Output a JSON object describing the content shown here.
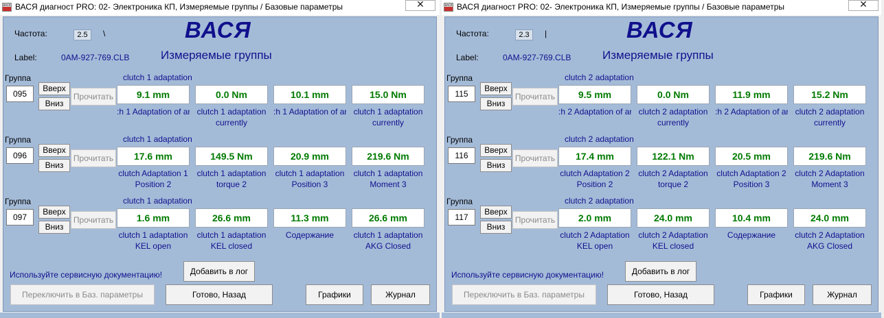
{
  "windows": [
    {
      "title": "ВАСЯ диагност PRO: 02- Электроника КП,  Измеряемые группы / Базовые параметры",
      "icon_text": "ВАСЯ",
      "close": "✕",
      "freq_label": "Частота:",
      "freq_value": "2.5",
      "spinner": "\\",
      "logo": "ВАСЯ",
      "label_label": "Label:",
      "label_value": "0AM-927-769.CLB",
      "heading": "Измеряемые группы",
      "groups": [
        {
          "label": "Группа",
          "number": "095",
          "up": "Вверх",
          "down": "Вниз",
          "read": "Прочитать",
          "title": "clutch 1 adaptation",
          "cells": [
            {
              "value": "9.1 mm",
              "desc1": ":h 1 Adaptation of ar",
              "desc2": ""
            },
            {
              "value": "0.0 Nm",
              "desc1": "clutch 1 adaptation",
              "desc2": "currently"
            },
            {
              "value": "10.1 mm",
              "desc1": ":h 1 Adaptation of ar",
              "desc2": ""
            },
            {
              "value": "15.0 Nm",
              "desc1": "clutch 1 adaptation",
              "desc2": "currently"
            }
          ]
        },
        {
          "label": "Группа",
          "number": "096",
          "up": "Вверх",
          "down": "Вниз",
          "read": "Прочитать",
          "title": "clutch 1 adaptation",
          "cells": [
            {
              "value": "17.6 mm",
              "desc1": "clutch Adaptation 1",
              "desc2": "Position 2"
            },
            {
              "value": "149.5 Nm",
              "desc1": "clutch 1 adaptation",
              "desc2": "torque 2"
            },
            {
              "value": "20.9 mm",
              "desc1": "clutch 1 adaptation",
              "desc2": "Position 3"
            },
            {
              "value": "219.6 Nm",
              "desc1": "clutch 1 adaptation",
              "desc2": "Moment 3"
            }
          ]
        },
        {
          "label": "Группа",
          "number": "097",
          "up": "Вверх",
          "down": "Вниз",
          "read": "Прочитать",
          "title": "clutch 1 adaptation",
          "cells": [
            {
              "value": "1.6 mm",
              "desc1": "clutch 1 adaptation",
              "desc2": "KEL open"
            },
            {
              "value": "26.6 mm",
              "desc1": "clutch 1 adaptation",
              "desc2": "KEL closed"
            },
            {
              "value": "11.3 mm",
              "desc1": "Содержание",
              "desc2": ""
            },
            {
              "value": "26.6 mm",
              "desc1": "clutch 1 adaptation",
              "desc2": "AKG Closed"
            }
          ]
        }
      ],
      "hint": "Используйте сервисную документацию!",
      "add_log": "Добавить в лог",
      "switch_basic": "Переключить в Баз. параметры",
      "done_back": "Готово, Назад",
      "graphs": "Графики",
      "journal": "Журнал"
    },
    {
      "title": "ВАСЯ диагност PRO: 02- Электроника КП,  Измеряемые группы / Базовые параметры",
      "icon_text": "ВАСЯ",
      "close": "✕",
      "freq_label": "Частота:",
      "freq_value": "2.3",
      "spinner": "|",
      "logo": "ВАСЯ",
      "label_label": "Label:",
      "label_value": "0AM-927-769.CLB",
      "heading": "Измеряемые группы",
      "groups": [
        {
          "label": "Группа",
          "number": "115",
          "up": "Вверх",
          "down": "Вниз",
          "read": "Прочитать",
          "title": "clutch 2 adaptation",
          "cells": [
            {
              "value": "9.5 mm",
              "desc1": ":h 2 Adaptation of ar",
              "desc2": ""
            },
            {
              "value": "0.0 Nm",
              "desc1": "clutch 2 adaptation",
              "desc2": "currently"
            },
            {
              "value": "11.9 mm",
              "desc1": ":h 2 Adaptation of ar",
              "desc2": ""
            },
            {
              "value": "15.2 Nm",
              "desc1": "clutch 2 adaptation",
              "desc2": "currently"
            }
          ]
        },
        {
          "label": "Группа",
          "number": "116",
          "up": "Вверх",
          "down": "Вниз",
          "read": "Прочитать",
          "title": "clutch 2 adaptation",
          "cells": [
            {
              "value": "17.4 mm",
              "desc1": "clutch Adaptation 2",
              "desc2": "Position 2"
            },
            {
              "value": "122.1 Nm",
              "desc1": "clutch 2 Adaptation",
              "desc2": "torque 2"
            },
            {
              "value": "20.5 mm",
              "desc1": "clutch Adaptation 2",
              "desc2": "Position 3"
            },
            {
              "value": "219.6 Nm",
              "desc1": "clutch 2 Adaptation",
              "desc2": "Moment 3"
            }
          ]
        },
        {
          "label": "Группа",
          "number": "117",
          "up": "Вверх",
          "down": "Вниз",
          "read": "Прочитать",
          "title": "clutch 2 adaptation",
          "cells": [
            {
              "value": "2.0 mm",
              "desc1": "clutch 2 Adaptation",
              "desc2": "KEL open"
            },
            {
              "value": "24.0 mm",
              "desc1": "clutch 2 Adaptation",
              "desc2": "KEL closed"
            },
            {
              "value": "10.4 mm",
              "desc1": "Содержание",
              "desc2": ""
            },
            {
              "value": "24.0 mm",
              "desc1": "clutch 2 Adaptation",
              "desc2": "AKG Closed"
            }
          ]
        }
      ],
      "hint": "Используйте сервисную документацию!",
      "add_log": "Добавить в лог",
      "switch_basic": "Переключить в Баз. параметры",
      "done_back": "Готово, Назад",
      "graphs": "Графики",
      "journal": "Журнал"
    }
  ]
}
